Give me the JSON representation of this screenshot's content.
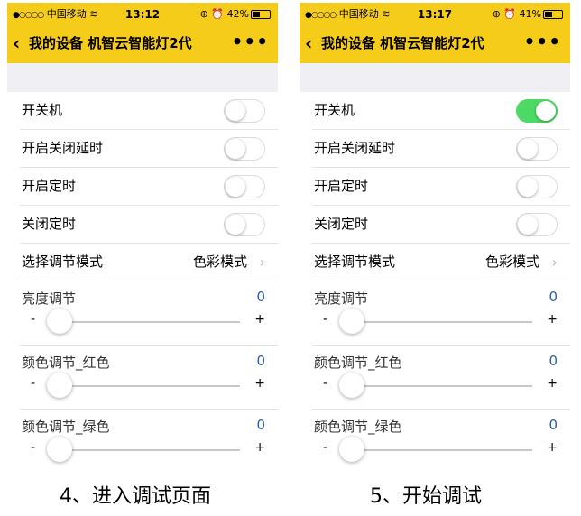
{
  "left": {
    "status": {
      "carrier": "中国移动",
      "time": "13:12",
      "battery": "42%"
    },
    "nav": {
      "title": "我的设备 机智云智能灯2代"
    },
    "toggles": [
      {
        "label": "开关机",
        "on": false
      },
      {
        "label": "开启关闭延时",
        "on": false
      },
      {
        "label": "开启定时",
        "on": false
      },
      {
        "label": "关闭定时",
        "on": false
      }
    ],
    "mode": {
      "label": "选择调节模式",
      "value": "色彩模式"
    },
    "sliders": [
      {
        "label": "亮度调节",
        "value": "0",
        "minus": "-",
        "plus": "+"
      },
      {
        "label": "颜色调节_红色",
        "value": "0",
        "minus": "-",
        "plus": "+"
      },
      {
        "label": "颜色调节_绿色",
        "value": "0",
        "minus": "-",
        "plus": "+"
      }
    ],
    "caption": "4、进入调试页面"
  },
  "right": {
    "status": {
      "carrier": "中国移动",
      "time": "13:17",
      "battery": "41%"
    },
    "nav": {
      "title": "我的设备 机智云智能灯2代"
    },
    "toggles": [
      {
        "label": "开关机",
        "on": true
      },
      {
        "label": "开启关闭延时",
        "on": false
      },
      {
        "label": "开启定时",
        "on": false
      },
      {
        "label": "关闭定时",
        "on": false
      }
    ],
    "mode": {
      "label": "选择调节模式",
      "value": "色彩模式"
    },
    "sliders": [
      {
        "label": "亮度调节",
        "value": "0",
        "minus": "-",
        "plus": "+"
      },
      {
        "label": "颜色调节_红色",
        "value": "0",
        "minus": "-",
        "plus": "+"
      },
      {
        "label": "颜色调节_绿色",
        "value": "0",
        "minus": "-",
        "plus": "+"
      }
    ],
    "caption": "5、开始调试"
  },
  "colors": {
    "header": "#f6cc1a",
    "toggle_on": "#4cd964",
    "value_text": "#2a5db0"
  }
}
